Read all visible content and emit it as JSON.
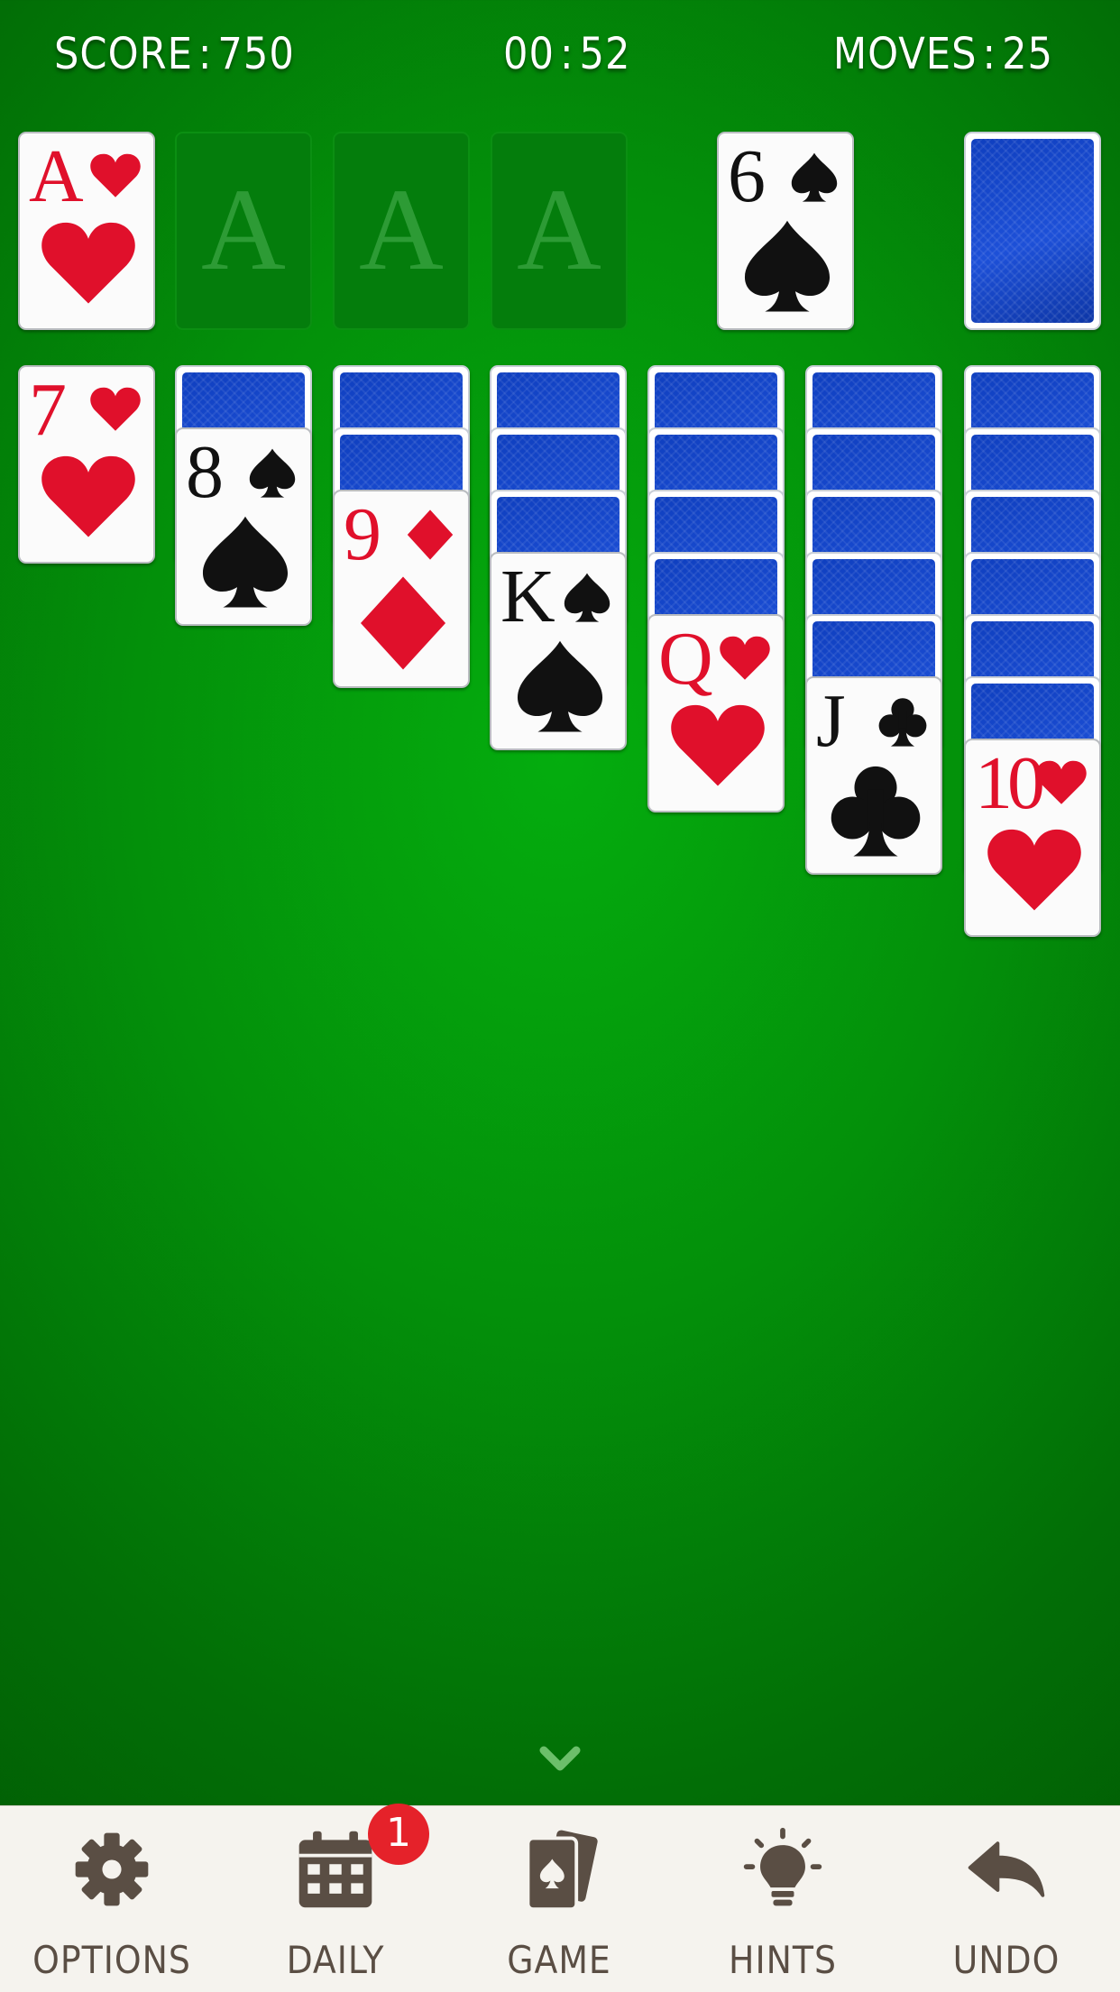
{
  "hud": {
    "score_label": "SCORE",
    "score_value": "750",
    "time_min": "00",
    "time_sec": "52",
    "moves_label": "MOVES",
    "moves_value": "25",
    "separator": ":"
  },
  "foundations": [
    {
      "rank": "A",
      "suit": "hearts",
      "color": "red",
      "empty": false
    },
    {
      "placeholder": "A",
      "empty": true
    },
    {
      "placeholder": "A",
      "empty": true
    },
    {
      "placeholder": "A",
      "empty": true
    }
  ],
  "waste": {
    "rank": "6",
    "suit": "spades",
    "color": "black"
  },
  "stock": {
    "face_down": true
  },
  "tableau": [
    {
      "hidden": 0,
      "rank": "7",
      "suit": "hearts",
      "color": "red"
    },
    {
      "hidden": 1,
      "rank": "8",
      "suit": "spades",
      "color": "black"
    },
    {
      "hidden": 2,
      "rank": "9",
      "suit": "diamonds",
      "color": "red"
    },
    {
      "hidden": 3,
      "rank": "K",
      "suit": "spades",
      "color": "black"
    },
    {
      "hidden": 4,
      "rank": "Q",
      "suit": "hearts",
      "color": "red"
    },
    {
      "hidden": 5,
      "rank": "J",
      "suit": "clubs",
      "color": "black"
    },
    {
      "hidden": 6,
      "rank": "10",
      "suit": "hearts",
      "color": "red"
    }
  ],
  "nav": [
    {
      "label": "OPTIONS",
      "icon": "gear-icon"
    },
    {
      "label": "DAILY",
      "icon": "calendar-icon"
    },
    {
      "label": "GAME",
      "icon": "cards-icon"
    },
    {
      "label": "HINTS",
      "icon": "lightbulb-icon"
    },
    {
      "label": "UNDO",
      "icon": "undo-arrow-icon"
    }
  ],
  "daily_badge": "1",
  "colors": {
    "felt": "#03900a",
    "red_suit": "#e0102b",
    "card_back": "#1d50d8",
    "badge": "#e5222a",
    "nav_text": "#5a4e44"
  }
}
